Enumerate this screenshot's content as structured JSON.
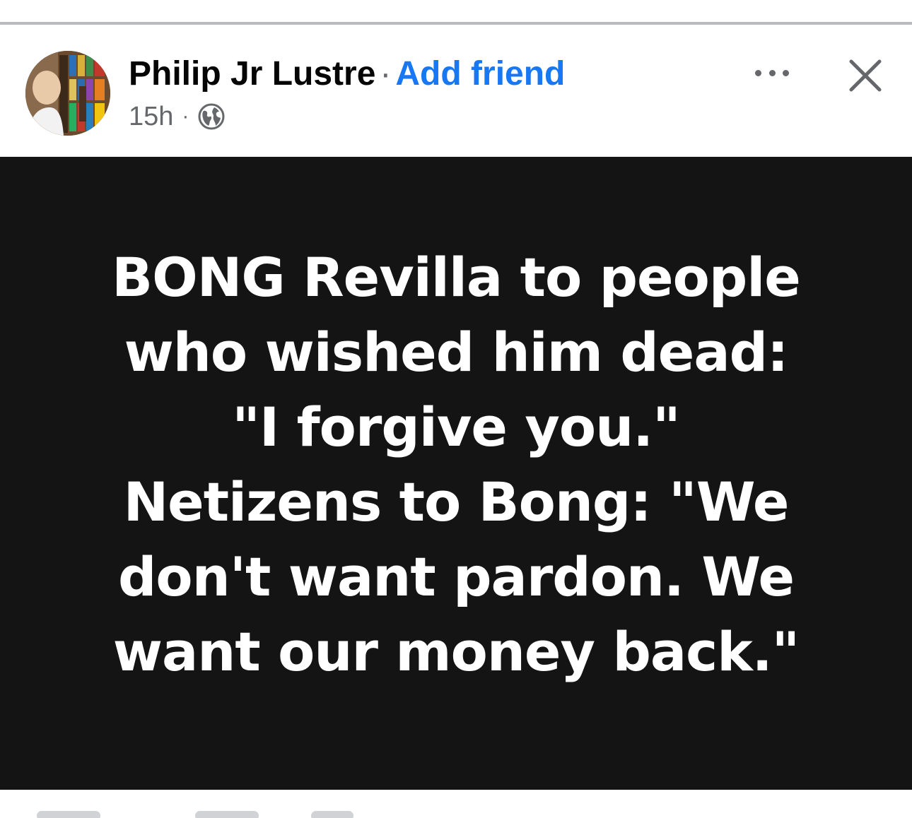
{
  "post": {
    "author": "Philip Jr Lustre",
    "separator": "·",
    "add_friend_label": "Add friend",
    "time_ago": "15h",
    "meta_separator": "·",
    "audience_icon": "globe-icon",
    "more_icon": "more-options-icon",
    "close_icon": "close-icon"
  },
  "content": {
    "lines": [
      "BONG Revilla to people",
      "who wished him dead:",
      "\"I forgive you.\"",
      "Netizens to Bong: \"We",
      "don't want pardon. We",
      "want our money back.\""
    ],
    "background_color": "#141414",
    "text_color": "#ffffff"
  },
  "colors": {
    "link": "#1877f2",
    "secondary_text": "#65676b",
    "primary_text": "#050505"
  }
}
